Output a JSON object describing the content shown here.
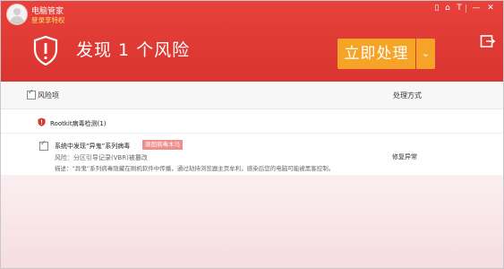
{
  "app": {
    "name": "电脑管家",
    "login_text": "登录享特权"
  },
  "toolbar": {
    "icons": [
      "phone-icon",
      "skin-icon",
      "shirt-icon",
      "minimize-icon",
      "close-icon"
    ],
    "icon_glyphs": [
      "▯",
      "⌂",
      "T",
      "—",
      "✕"
    ]
  },
  "header": {
    "title": "发现 1 个风险",
    "action_label": "立即处理",
    "dropdown_glyph": "⌄",
    "side_icon": "exit-icon"
  },
  "columns": {
    "risk_label": "风险项",
    "action_label": "处理方式"
  },
  "category": {
    "label": "Rootkit病毒检测(1)"
  },
  "item": {
    "name": "系统中发现“异鬼”系列病毒",
    "tag": "顽固病毒木马",
    "risk_line": "风险：分区引导记录(VBR)被篡改",
    "desc_line": "描述：“异鬼”系列病毒隐藏在刷机软件中传播，通过劫持浏览器主页牟利，感染后您的电脑可能被黑客控制。",
    "action": "修复异常"
  },
  "colors": {
    "header_red": "#e03c36",
    "action_orange": "#f5a428",
    "tag_pink": "#ef8e8a"
  }
}
